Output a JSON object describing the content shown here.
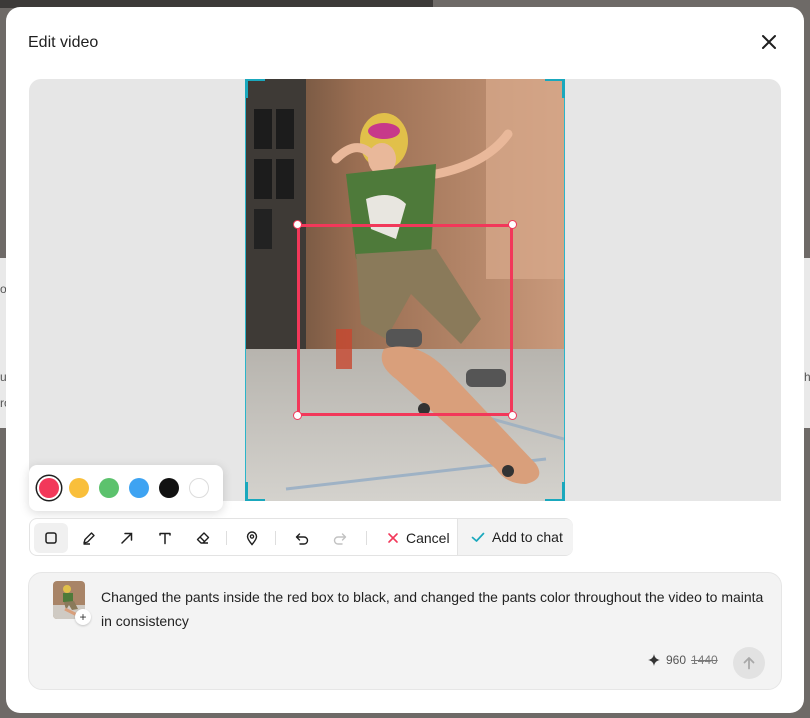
{
  "dialog": {
    "title": "Edit video",
    "close_icon": "close-icon"
  },
  "backdrop": {
    "left_glyphs": [
      "o",
      "u",
      "ro"
    ],
    "right_glyph": "h"
  },
  "palette": {
    "colors": [
      {
        "name": "red",
        "hex": "#f2385a",
        "selected": true
      },
      {
        "name": "yellow",
        "hex": "#f9bf3b"
      },
      {
        "name": "green",
        "hex": "#5cc26d"
      },
      {
        "name": "blue",
        "hex": "#3ea3f2"
      },
      {
        "name": "black",
        "hex": "#111111"
      },
      {
        "name": "white",
        "hex": "#ffffff"
      }
    ]
  },
  "toolbar": {
    "tools": [
      "rectangle-icon",
      "pen-icon",
      "arrow-icon",
      "text-icon",
      "eraser-icon",
      "location-pin-icon",
      "undo-icon",
      "redo-icon"
    ],
    "cancel_label": "Cancel",
    "add_label": "Add to chat"
  },
  "prompt": {
    "text": "Changed the pants inside the red box to black, and changed the pants color throughout the video to maintain consistency",
    "thumb_plus": "+",
    "credits": "960",
    "credits_old": "1440"
  },
  "colors": {
    "accent": "#f2385a",
    "frame": "#1aa8bd",
    "check": "#1aa8bd"
  }
}
